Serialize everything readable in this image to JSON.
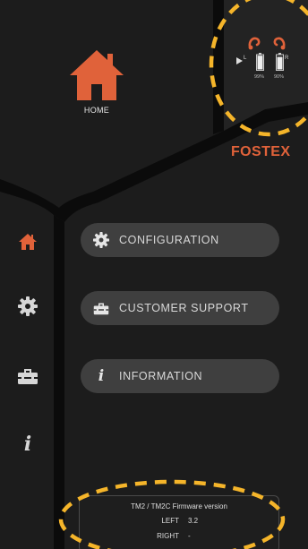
{
  "header": {
    "home_label": "HOME",
    "brand": "FOSTEX"
  },
  "status": {
    "left": {
      "channel": "L",
      "battery": "99%",
      "battery_level": 0.99
    },
    "right": {
      "channel": "R",
      "battery": "90%",
      "battery_level": 0.9
    }
  },
  "sidebar": {
    "items": [
      {
        "name": "home",
        "icon": "home-icon",
        "active": true
      },
      {
        "name": "configuration",
        "icon": "gear-icon",
        "active": false
      },
      {
        "name": "customer-support",
        "icon": "toolbox-icon",
        "active": false
      },
      {
        "name": "information",
        "icon": "info-icon",
        "active": false
      }
    ]
  },
  "menu": {
    "configuration": "CONFIGURATION",
    "customer_support": "CUSTOMER SUPPORT",
    "information": "INFORMATION",
    "info_glyph": "i"
  },
  "firmware": {
    "title": "TM2 / TM2C Firmware version",
    "left_label": "LEFT",
    "left_value": "3.2",
    "right_label": "RIGHT",
    "right_value": "-"
  },
  "colors": {
    "accent": "#e0623a",
    "highlight_dash": "#f5b52a",
    "background": "#1c1c1c",
    "button": "#3f3f3f"
  }
}
